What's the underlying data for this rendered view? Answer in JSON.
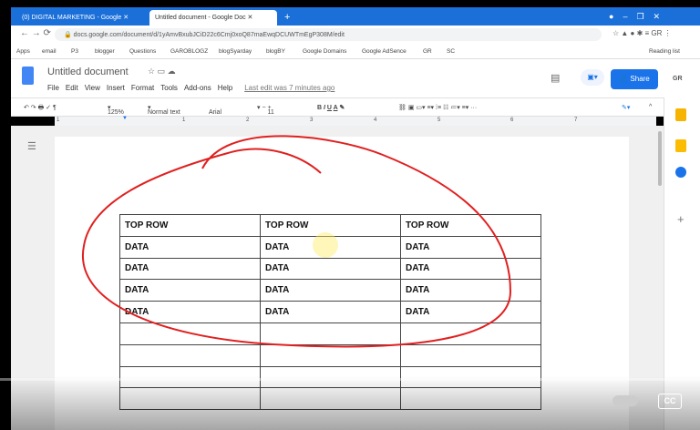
{
  "browser": {
    "tabs": [
      {
        "label": "(0) DIGITAL MARKETING - Google"
      },
      {
        "label": "Untitled document - Google Doc"
      }
    ],
    "new_tab": "+",
    "url": "docs.google.com/document/d/1yAmvBxubJCiD22c6Cmj0xoQ87maEwqDCUWTmEgP308M/edit",
    "profile": "GR",
    "bookmarks": [
      "Apps",
      "email",
      "P3",
      "blogger",
      "Questions",
      "GAROBLOGZ",
      "blogSyarday",
      "blogBY",
      "Google Domains",
      "Google AdSence",
      "GR",
      "SC",
      "Reading list"
    ]
  },
  "doc": {
    "title": "Untitled document",
    "menu": [
      "File",
      "Edit",
      "View",
      "Insert",
      "Format",
      "Tools",
      "Add-ons",
      "Help"
    ],
    "last_edit": "Last edit was 7 minutes ago",
    "share": "Share",
    "avatar": "GR"
  },
  "toolbar": {
    "zoom": "125%",
    "style": "Normal text",
    "font": "Arial",
    "size": "11"
  },
  "ruler": [
    "1",
    "1",
    "2",
    "3",
    "4",
    "5",
    "6",
    "7"
  ],
  "table": {
    "rows": [
      [
        "TOP ROW",
        "TOP ROW",
        "TOP ROW"
      ],
      [
        "DATA",
        "DATA",
        "DATA"
      ],
      [
        "DATA",
        "DATA",
        "DATA"
      ],
      [
        "DATA",
        "DATA",
        "DATA"
      ],
      [
        "DATA",
        "DATA",
        "DATA"
      ],
      [
        "",
        "",
        ""
      ],
      [
        "",
        "",
        ""
      ],
      [
        "",
        "",
        ""
      ],
      [
        "",
        "",
        ""
      ]
    ]
  },
  "video": {
    "cc": "CC"
  },
  "colors": {
    "tabbar": "#1b6fd8",
    "accent": "#1a73e8",
    "annotation": "#e02020"
  }
}
